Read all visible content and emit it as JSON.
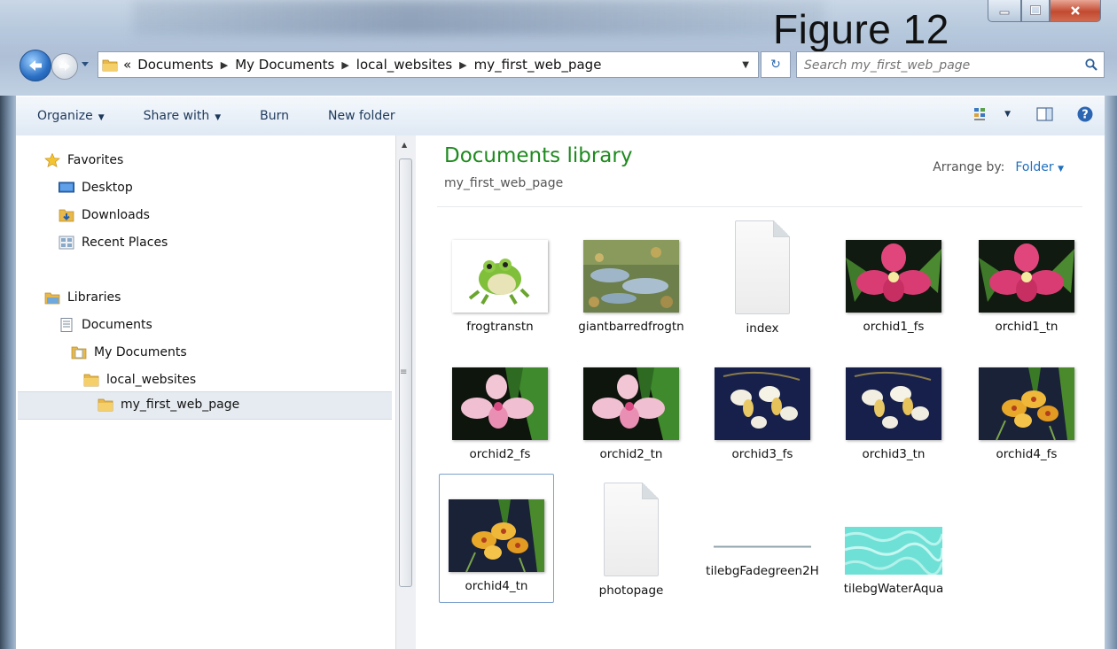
{
  "window": {
    "figure_label": "Figure 12",
    "controls": {
      "minimize": "minimize",
      "maximize": "maximize",
      "close": "close"
    }
  },
  "nav": {
    "breadcrumb_lead": "«",
    "breadcrumbs": [
      "Documents",
      "My Documents",
      "local_websites",
      "my_first_web_page"
    ],
    "search_placeholder": "Search my_first_web_page"
  },
  "toolbar": {
    "organize": "Organize",
    "share_with": "Share with",
    "burn": "Burn",
    "new_folder": "New folder"
  },
  "sidebar": {
    "favorites": "Favorites",
    "desktop": "Desktop",
    "downloads": "Downloads",
    "recent_places": "Recent Places",
    "libraries": "Libraries",
    "documents": "Documents",
    "my_documents": "My Documents",
    "local_websites": "local_websites",
    "my_first_web_page": "my_first_web_page"
  },
  "main": {
    "title": "Documents library",
    "subtitle": "my_first_web_page",
    "arrange_label": "Arrange by:",
    "arrange_value": "Folder",
    "files": [
      {
        "name": "frogtranstn",
        "kind": "image",
        "icon": "frog-thumbnail"
      },
      {
        "name": "giantbarredfrogtn",
        "kind": "image",
        "icon": "pond-thumbnail"
      },
      {
        "name": "index",
        "kind": "document",
        "icon": "blank-document-icon"
      },
      {
        "name": "orchid1_fs",
        "kind": "image",
        "icon": "pink-orchid-thumbnail"
      },
      {
        "name": "orchid1_tn",
        "kind": "image",
        "icon": "pink-orchid-thumbnail"
      },
      {
        "name": "orchid2_fs",
        "kind": "image",
        "icon": "light-pink-orchid-thumbnail"
      },
      {
        "name": "orchid2_tn",
        "kind": "image",
        "icon": "light-pink-orchid-thumbnail"
      },
      {
        "name": "orchid3_fs",
        "kind": "image",
        "icon": "white-orchid-thumbnail"
      },
      {
        "name": "orchid3_tn",
        "kind": "image",
        "icon": "white-orchid-thumbnail"
      },
      {
        "name": "orchid4_fs",
        "kind": "image",
        "icon": "yellow-orchid-thumbnail"
      },
      {
        "name": "orchid4_tn",
        "kind": "image",
        "icon": "yellow-orchid-thumbnail"
      },
      {
        "name": "photopage",
        "kind": "document",
        "icon": "blank-document-icon"
      },
      {
        "name": "tilebgFadegreen2H",
        "kind": "image",
        "icon": "thin-line-thumbnail"
      },
      {
        "name": "tilebgWaterAqua",
        "kind": "image",
        "icon": "aqua-water-thumbnail"
      }
    ]
  },
  "colors": {
    "library_title": "#1e8a1e",
    "link_blue": "#1f6fbf",
    "selection_border": "#7da2ce"
  }
}
